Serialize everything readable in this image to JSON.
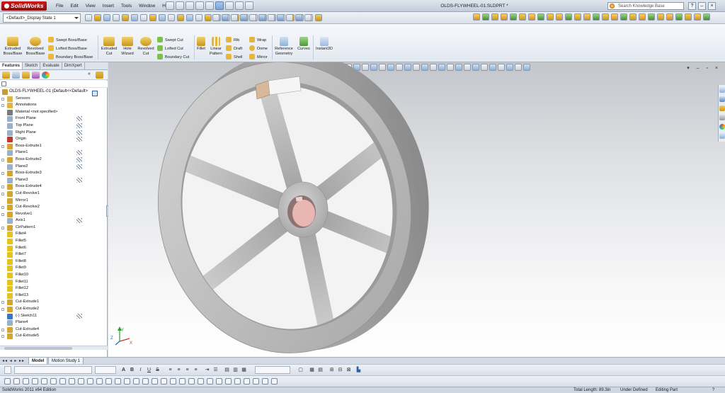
{
  "app": {
    "name": "SolidWorks",
    "document_title": "OLDS-FLYWHEEL-01.SLDPRT *"
  },
  "menu": [
    "File",
    "Edit",
    "View",
    "Insert",
    "Tools",
    "Window",
    "Help"
  ],
  "search": {
    "placeholder": "Search Knowledge Base"
  },
  "window_controls": [
    "?",
    "–",
    "×"
  ],
  "config_select": {
    "value": "<Default>_Display State 1"
  },
  "commands": {
    "extruded_boss": "Extruded Boss/Base",
    "revolved_boss": "Revolved Boss/Base",
    "swept_boss": "Swept Boss/Base",
    "lofted_boss": "Lofted Boss/Base",
    "boundary_boss": "Boundary Boss/Base",
    "extruded_cut": "Extruded Cut",
    "hole_wizard": "Hole Wizard",
    "revolved_cut": "Revolved Cut",
    "swept_cut": "Swept Cut",
    "lofted_cut": "Lofted Cut",
    "boundary_cut": "Boundary Cut",
    "fillet": "Fillet",
    "linear_pattern": "Linear Pattern",
    "rib": "Rib",
    "draft": "Draft",
    "shell": "Shell",
    "wrap": "Wrap",
    "dome": "Dome",
    "mirror": "Mirror",
    "reference_geometry": "Reference Geometry",
    "curves": "Curves",
    "instant3d": "Instant3D"
  },
  "panel_tabs": [
    "Features",
    "Sketch",
    "Evaluate",
    "DimXpert"
  ],
  "feature_tree": [
    {
      "label": "OLDS-FLYWHEEL-01  (Default<<Default>",
      "icon": "part-icon",
      "color": "#c79a3a",
      "expand": false,
      "root": true
    },
    {
      "label": "Sensors",
      "icon": "sensors-icon",
      "color": "#e0b640",
      "expand": true
    },
    {
      "label": "Annotations",
      "icon": "annotations-icon",
      "color": "#e0b640",
      "expand": true
    },
    {
      "label": "Material <not specified>",
      "icon": "material-icon",
      "color": "#7a7a7a",
      "expand": false
    },
    {
      "label": "Front Plane",
      "icon": "plane-icon",
      "color": "#9ab0c8",
      "expand": false,
      "hint": true
    },
    {
      "label": "Top Plane",
      "icon": "plane-icon",
      "color": "#9ab0c8",
      "expand": false,
      "hint": true
    },
    {
      "label": "Right Plane",
      "icon": "plane-icon",
      "color": "#9ab0c8",
      "expand": false,
      "hint": true
    },
    {
      "label": "Origin",
      "icon": "origin-icon",
      "color": "#c0392b",
      "expand": false,
      "hint": true
    },
    {
      "label": "Boss-Extrude1",
      "icon": "boss-extrude-icon",
      "color": "#d7a52a",
      "expand": true
    },
    {
      "label": "Plane1",
      "icon": "plane-icon",
      "color": "#9ab0c8",
      "expand": false,
      "hint": true
    },
    {
      "label": "Boss-Extrude2",
      "icon": "boss-extrude-icon",
      "color": "#d7a52a",
      "expand": true,
      "hint": true
    },
    {
      "label": "Plane2",
      "icon": "plane-icon",
      "color": "#9ab0c8",
      "expand": false,
      "hint": true
    },
    {
      "label": "Boss-Extrude3",
      "icon": "boss-extrude-icon",
      "color": "#d7a52a",
      "expand": true
    },
    {
      "label": "Plane3",
      "icon": "plane-icon",
      "color": "#9ab0c8",
      "expand": false,
      "hint": true
    },
    {
      "label": "Boss-Extrude4",
      "icon": "boss-extrude-icon",
      "color": "#d7a52a",
      "expand": true
    },
    {
      "label": "Cut-Revolve1",
      "icon": "cut-revolve-icon",
      "color": "#d7a52a",
      "expand": true
    },
    {
      "label": "Mirror1",
      "icon": "mirror-icon",
      "color": "#d7a52a",
      "expand": false
    },
    {
      "label": "Cut-Revolve2",
      "icon": "cut-revolve-icon",
      "color": "#d7a52a",
      "expand": true
    },
    {
      "label": "Revolve1",
      "icon": "revolve-icon",
      "color": "#d7a52a",
      "expand": true
    },
    {
      "label": "Axis1",
      "icon": "axis-icon",
      "color": "#9ab0c8",
      "expand": false,
      "hint": true
    },
    {
      "label": "CirPattern1",
      "icon": "circular-pattern-icon",
      "color": "#d7a52a",
      "expand": true
    },
    {
      "label": "Fillet4",
      "icon": "fillet-icon",
      "color": "#e6c21c",
      "expand": false
    },
    {
      "label": "Fillet5",
      "icon": "fillet-icon",
      "color": "#e6c21c",
      "expand": false
    },
    {
      "label": "Fillet6",
      "icon": "fillet-icon",
      "color": "#e6c21c",
      "expand": false
    },
    {
      "label": "Fillet7",
      "icon": "fillet-icon",
      "color": "#e6c21c",
      "expand": false
    },
    {
      "label": "Fillet8",
      "icon": "fillet-icon",
      "color": "#e6c21c",
      "expand": false
    },
    {
      "label": "Fillet9",
      "icon": "fillet-icon",
      "color": "#e6c21c",
      "expand": false
    },
    {
      "label": "Fillet10",
      "icon": "fillet-icon",
      "color": "#e6c21c",
      "expand": false
    },
    {
      "label": "Fillet11",
      "icon": "fillet-icon",
      "color": "#e6c21c",
      "expand": false
    },
    {
      "label": "Fillet12",
      "icon": "fillet-icon",
      "color": "#e6c21c",
      "expand": false
    },
    {
      "label": "Fillet13",
      "icon": "fillet-icon",
      "color": "#e6c21c",
      "expand": false
    },
    {
      "label": "Cut-Extrude1",
      "icon": "cut-extrude-icon",
      "color": "#d7a52a",
      "expand": true
    },
    {
      "label": "Cut-Extrude2",
      "icon": "cut-extrude-icon",
      "color": "#d7a52a",
      "expand": true
    },
    {
      "label": "(-) Sketch11",
      "icon": "sketch-icon",
      "color": "#3a74c8",
      "expand": false,
      "hint": true
    },
    {
      "label": "Plane4",
      "icon": "plane-icon",
      "color": "#9ab0c8",
      "expand": false
    },
    {
      "label": "Cut-Extrude4",
      "icon": "cut-extrude-icon",
      "color": "#d7a52a",
      "expand": true
    },
    {
      "label": "Cut-Extrude5",
      "icon": "cut-extrude-icon",
      "color": "#d7a52a",
      "expand": true
    }
  ],
  "bottom_tabs": [
    "Model",
    "Motion Study 1"
  ],
  "status": {
    "edition": "SolidWorks 2011 x64 Edition",
    "total_length": "Total Length: 89.3in",
    "definition": "Under Defined",
    "mode": "Editing Part"
  },
  "colors": {
    "model_fill": "#bfbfbf",
    "bore_fill": "#e9b7b2",
    "brand_red": "#b31212"
  }
}
